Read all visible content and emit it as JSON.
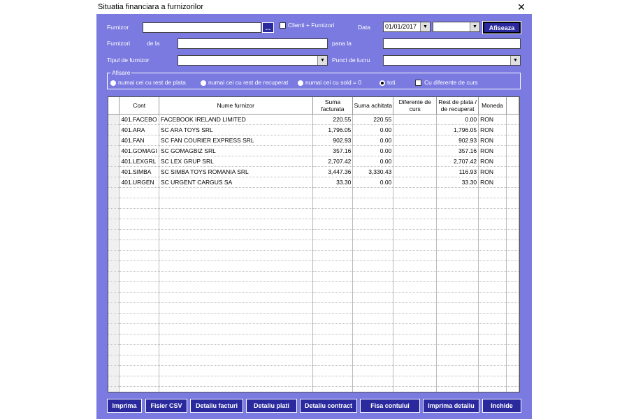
{
  "window": {
    "title": "Situatia financiara a furnizorilor",
    "close": "✕"
  },
  "filters": {
    "furnizor_label": "Furnizor",
    "furnizor_browse": "...",
    "clienti_furnizori_label": "Clienti + Furnizori",
    "data_label": "Data",
    "data_value": "01/01/2017",
    "afiseaza": "Afiseaza",
    "furnizori_label": "Furnizori",
    "de_la_label": "de la",
    "pana_la_label": "pana la",
    "tip_label": "Tipul de furnizor",
    "punct_label": "Punct de lucru"
  },
  "afisare": {
    "legend": "Afisare",
    "options": [
      "numai cei cu rest de plata",
      "numai cei cu rest de recuperat",
      "numai cei cu sold = 0",
      "toti"
    ],
    "selected": "toti",
    "diferente_label": "Cu diferente de curs"
  },
  "table": {
    "headers": [
      "Cont",
      "Nume furnizor",
      "Suma facturata",
      "Suma achitata",
      "Diferente de curs",
      "Rest de plata / de recuperat",
      "Moneda"
    ],
    "rows": [
      [
        "401.FACEBO",
        "FACEBOOK IRELAND LIMITED",
        "220.55",
        "220.55",
        "",
        "0.00",
        "RON"
      ],
      [
        "401.ARA",
        "SC ARA TOYS SRL",
        "1,796.05",
        "0.00",
        "",
        "1,796.05",
        "RON"
      ],
      [
        "401.FAN",
        "SC FAN COURIER EXPRESS SRL",
        "902.93",
        "0.00",
        "",
        "902.93",
        "RON"
      ],
      [
        "401.GOMAGI",
        "SC GOMAGBIZ SRL",
        "357.16",
        "0.00",
        "",
        "357.16",
        "RON"
      ],
      [
        "401.LEXGRL",
        "SC LEX GRUP SRL",
        "2,707.42",
        "0.00",
        "",
        "2,707.42",
        "RON"
      ],
      [
        "401.SIMBA",
        "SC SIMBA TOYS ROMANIA SRL",
        "3,447.36",
        "3,330.43",
        "",
        "116.93",
        "RON"
      ],
      [
        "401.URGEN",
        "SC URGENT CARGUS SA",
        "33.30",
        "0.00",
        "",
        "33.30",
        "RON"
      ]
    ]
  },
  "buttons": {
    "imprima": "Imprima",
    "csv": "Fisier CSV",
    "facturi": "Detaliu facturi",
    "plati": "Detaliu plati",
    "contract": "Detaliu contract",
    "fisa": "Fisa contului",
    "imprima_detaliu": "Imprima detaliu",
    "inchide": "Inchide"
  }
}
